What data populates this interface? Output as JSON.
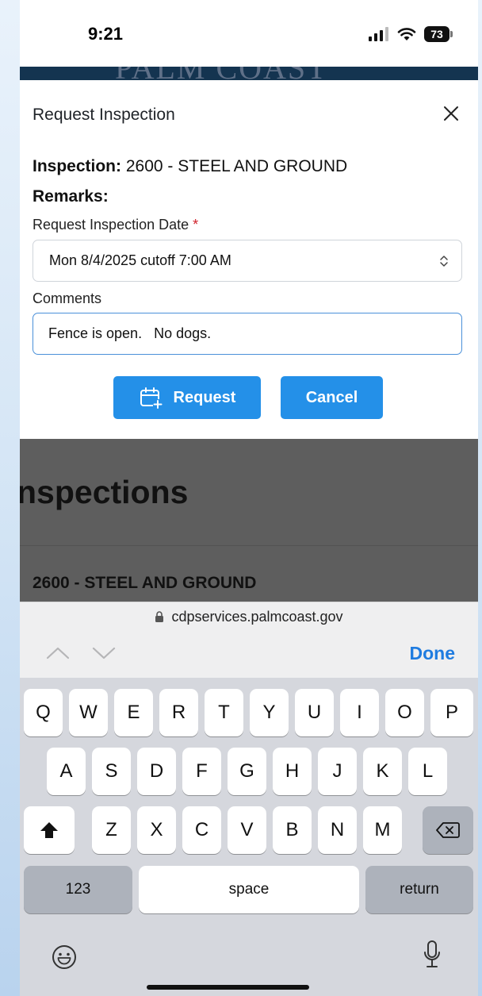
{
  "status_bar": {
    "time": "9:21",
    "battery": "73"
  },
  "banner": {
    "text": "PALM COAST"
  },
  "modal": {
    "title": "Request Inspection",
    "inspection_label": "Inspection:",
    "inspection_value": "2600 - STEEL AND GROUND",
    "remarks_label": "Remarks:",
    "date_label": "Request Inspection Date",
    "required_mark": "*",
    "date_value": "Mon 8/4/2025 cutoff 7:00 AM",
    "comments_label": "Comments",
    "comments_value": "Fence is open.   No dogs.",
    "request_label": "Request",
    "cancel_label": "Cancel"
  },
  "background": {
    "heading": "nspections",
    "item": "2600 - STEEL AND GROUND"
  },
  "url_bar": {
    "url": "cdpservices.palmcoast.gov"
  },
  "accessory_bar": {
    "done_label": "Done"
  },
  "keyboard": {
    "row1": [
      "Q",
      "W",
      "E",
      "R",
      "T",
      "Y",
      "U",
      "I",
      "O",
      "P"
    ],
    "row2": [
      "A",
      "S",
      "D",
      "F",
      "G",
      "H",
      "J",
      "K",
      "L"
    ],
    "row3": [
      "Z",
      "X",
      "C",
      "V",
      "B",
      "N",
      "M"
    ],
    "numbers_label": "123",
    "space_label": "space",
    "return_label": "return"
  },
  "colors": {
    "accent": "#2490e8",
    "done": "#1f7ce0",
    "required": "#d0202a",
    "banner": "#143450"
  }
}
